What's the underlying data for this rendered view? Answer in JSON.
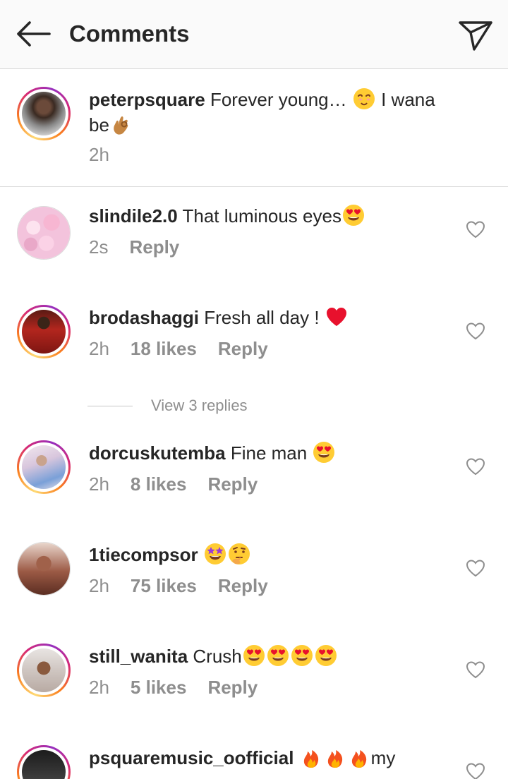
{
  "header": {
    "title": "Comments",
    "back_icon": "arrow-left-icon",
    "send_icon": "paper-plane-icon"
  },
  "caption": {
    "username": "peterpsquare",
    "text_part1": "Forever young…",
    "text_part2": "I wana be",
    "emojis": [
      "face-with-hand-over-mouth-emoji",
      "ok-hand-emoji"
    ],
    "time": "2h"
  },
  "comments": [
    {
      "username": "slindile2.0",
      "text": "That luminous eyes",
      "emojis": [
        "heart-eyes-emoji"
      ],
      "time": "2s",
      "likes": "",
      "reply": "Reply"
    },
    {
      "username": "brodashaggi",
      "text": "Fresh all day !",
      "emojis": [
        "red-heart-emoji"
      ],
      "time": "2h",
      "likes": "18 likes",
      "reply": "Reply"
    },
    {
      "username": "dorcuskutemba",
      "text": "Fine man",
      "emojis": [
        "heart-eyes-emoji"
      ],
      "time": "2h",
      "likes": "8 likes",
      "reply": "Reply"
    },
    {
      "username": "1tiecompsor",
      "text": "",
      "emojis": [
        "star-struck-emoji",
        "thinking-face-emoji"
      ],
      "time": "2h",
      "likes": "75 likes",
      "reply": "Reply"
    },
    {
      "username": "still_wanita",
      "text": "Crush",
      "emojis": [
        "heart-eyes-emoji",
        "heart-eyes-emoji",
        "heart-eyes-emoji",
        "heart-eyes-emoji"
      ],
      "time": "2h",
      "likes": "5 likes",
      "reply": "Reply"
    },
    {
      "username": "psquaremusic_oofficial",
      "text": "my",
      "emojis": [
        "fire-emoji",
        "fire-emoji",
        "fire-emoji"
      ],
      "time": "",
      "likes": "",
      "reply": ""
    }
  ],
  "view_replies": "View 3 replies",
  "colors": {
    "text": "#262626",
    "secondary": "#8e8e8e",
    "divider": "#dbdbdb",
    "header_bg": "#fafafa"
  }
}
